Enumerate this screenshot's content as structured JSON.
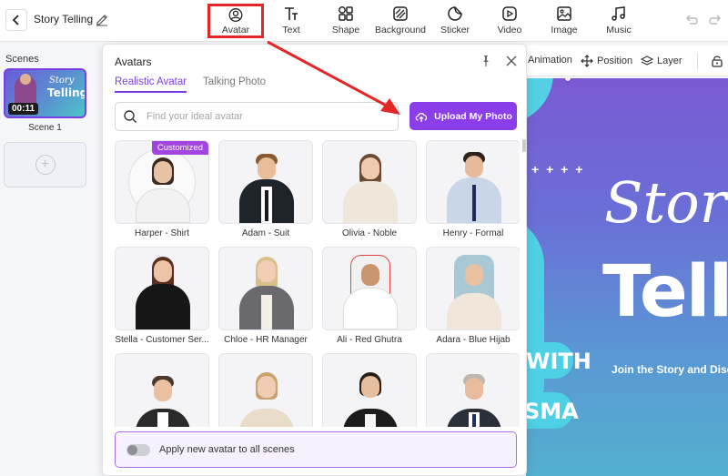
{
  "header": {
    "project_title": "Story Telling",
    "tools": [
      {
        "label": "Avatar",
        "icon": "avatar-icon"
      },
      {
        "label": "Text",
        "icon": "text-icon"
      },
      {
        "label": "Shape",
        "icon": "shape-icon"
      },
      {
        "label": "Background",
        "icon": "background-icon"
      },
      {
        "label": "Sticker",
        "icon": "sticker-icon"
      },
      {
        "label": "Video",
        "icon": "video-icon"
      },
      {
        "label": "Image",
        "icon": "image-icon"
      },
      {
        "label": "Music",
        "icon": "music-icon"
      }
    ],
    "active_tool": "Avatar"
  },
  "scenes": {
    "title": "Scenes",
    "items": [
      {
        "label": "Scene 1",
        "duration": "00:11",
        "thumb_text_1": "Story",
        "thumb_text_2": "Telling"
      }
    ]
  },
  "properties": {
    "animation": "Animation",
    "position": "Position",
    "layer": "Layer"
  },
  "canvas": {
    "dots": "+ + + +",
    "title_1": "Stor",
    "title_2": "Tellir",
    "subtitle": "Join the Story and Discov",
    "pill_1": "WITH",
    "pill_2": "SMA"
  },
  "avatar_panel": {
    "title": "Avatars",
    "tabs": [
      {
        "label": "Realistic Avatar",
        "active": true
      },
      {
        "label": "Talking Photo",
        "active": false
      }
    ],
    "search_placeholder": "Find your ideal avatar",
    "upload_label": "Upload My Photo",
    "customized_badge": "Customized",
    "avatars": [
      {
        "name": "Harper - Shirt"
      },
      {
        "name": "Adam - Suit"
      },
      {
        "name": "Olivia - Noble"
      },
      {
        "name": "Henry - Formal"
      },
      {
        "name": "Stella - Customer Ser..."
      },
      {
        "name": "Chloe - HR Manager"
      },
      {
        "name": "Ali - Red Ghutra"
      },
      {
        "name": "Adara - Blue Hijab"
      },
      {
        "name": ""
      },
      {
        "name": ""
      },
      {
        "name": ""
      },
      {
        "name": ""
      }
    ],
    "apply_all_label": "Apply new avatar to all scenes"
  },
  "colors": {
    "accent": "#8a3de8",
    "highlight": "#e32626"
  }
}
